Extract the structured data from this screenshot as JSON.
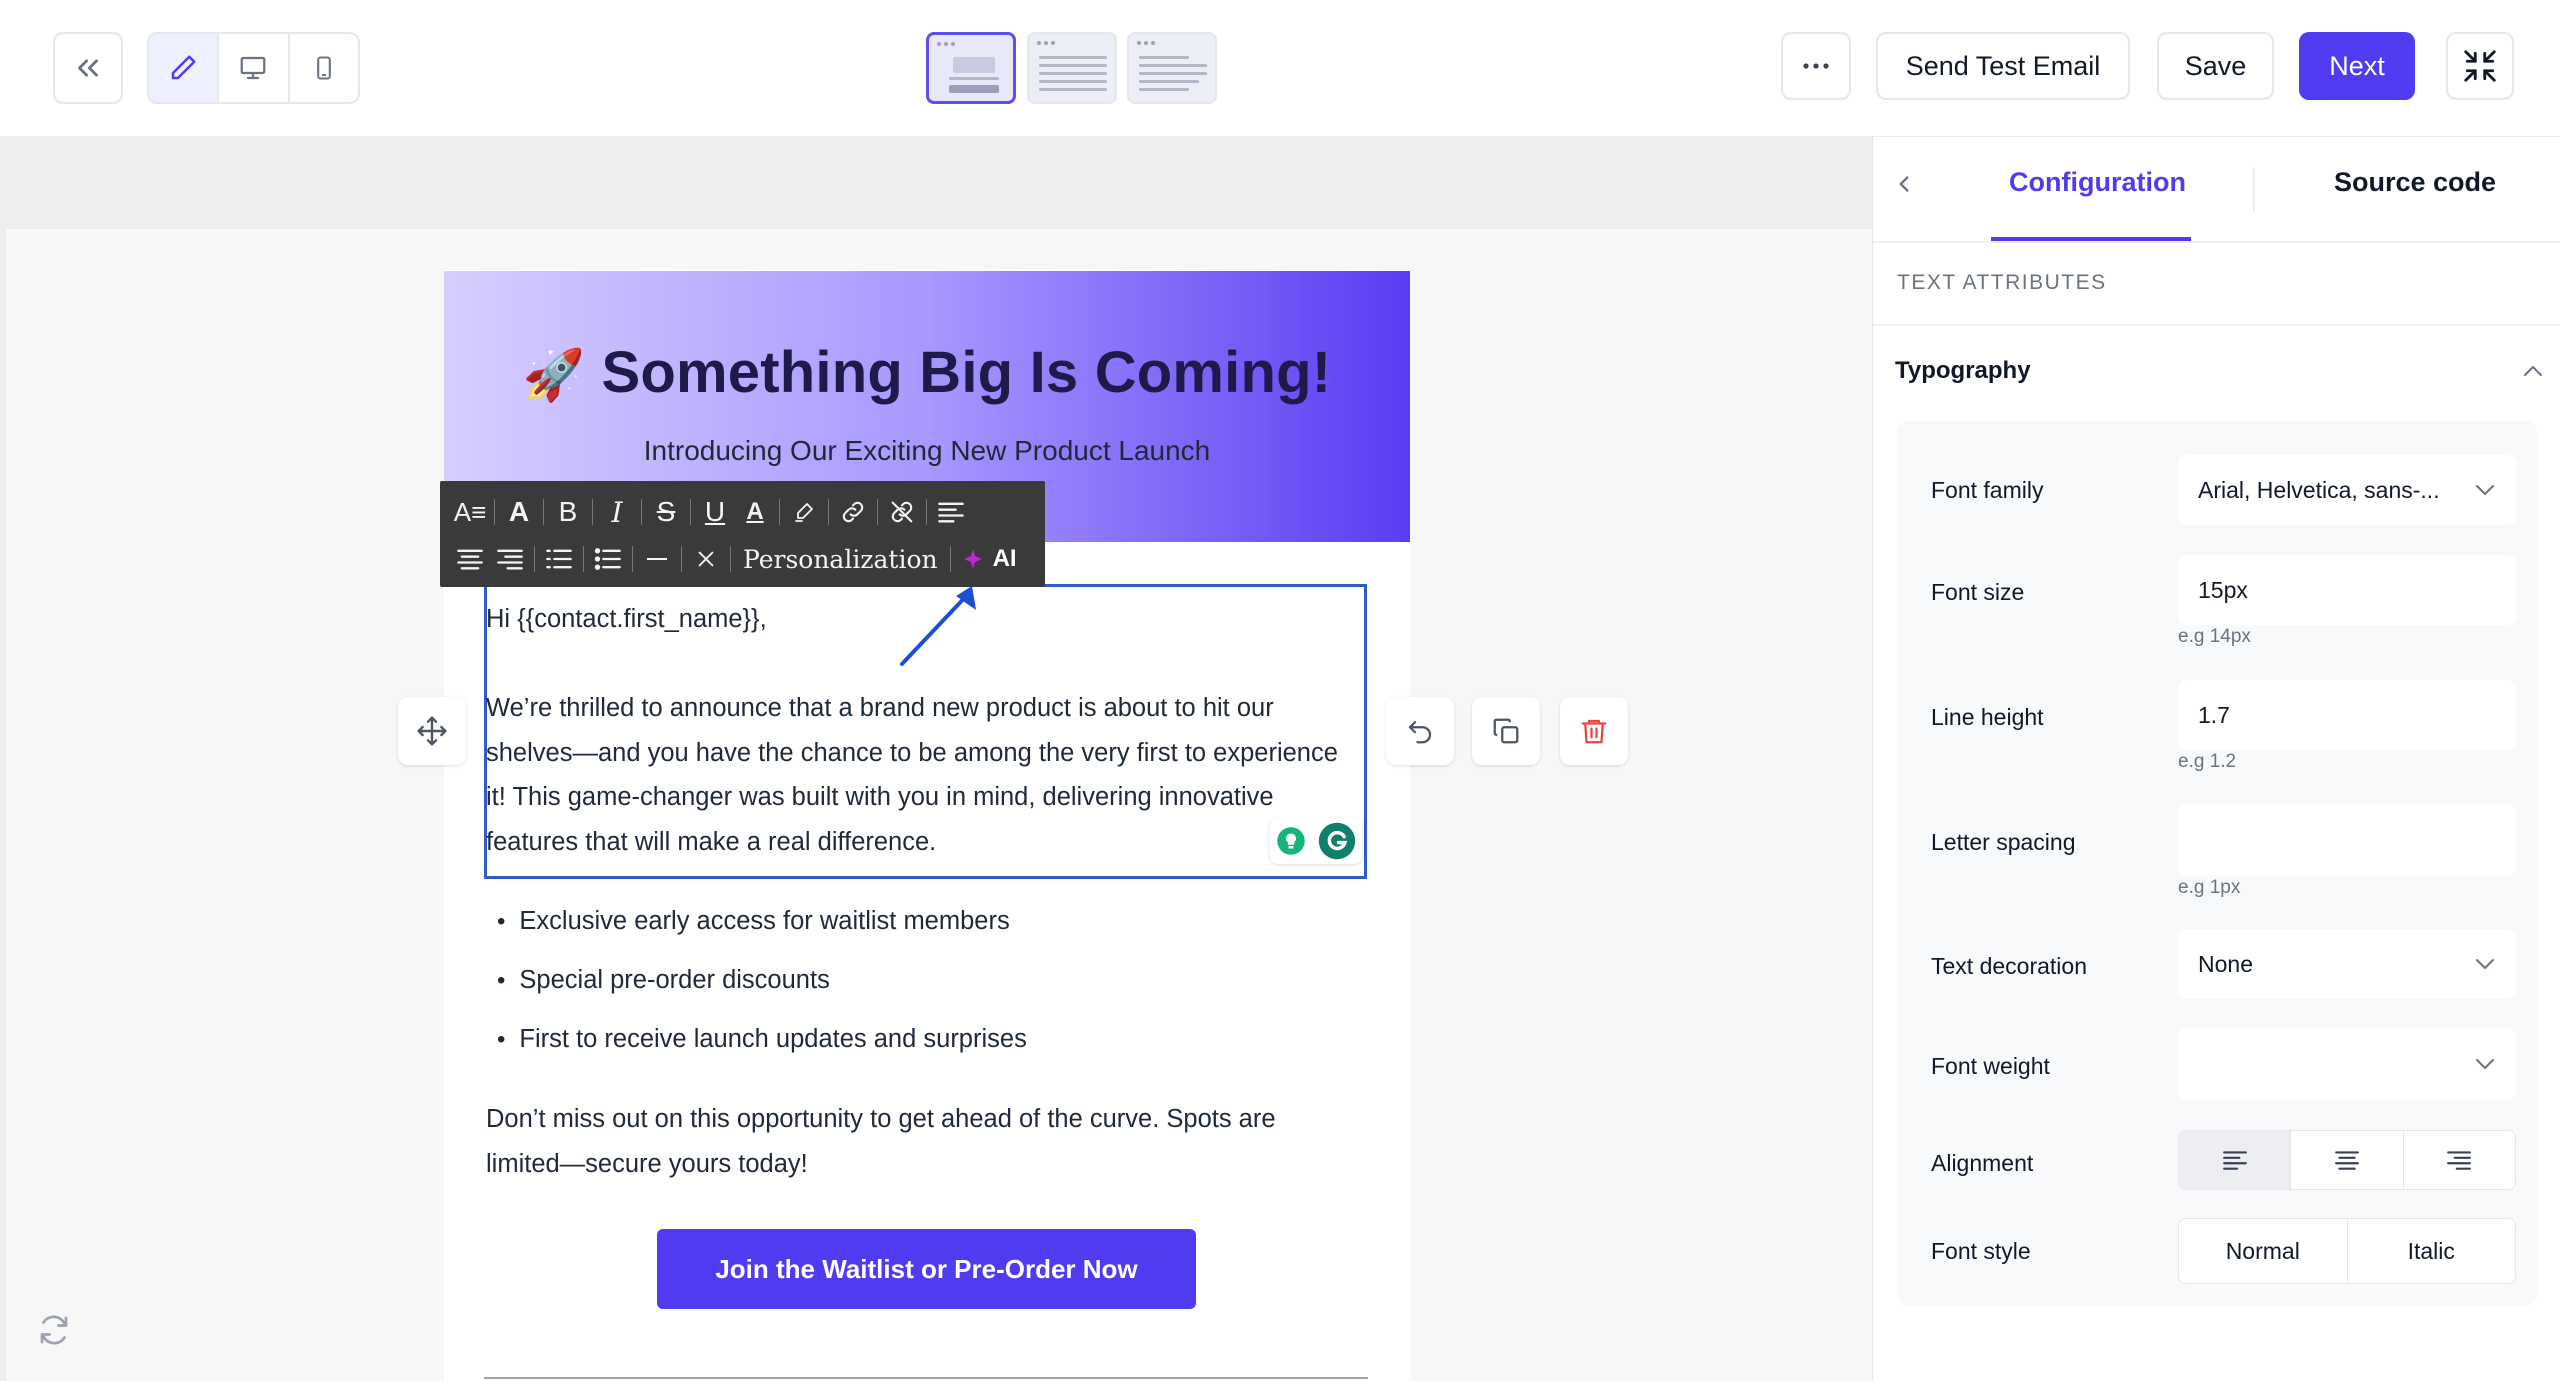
{
  "toolbar": {
    "back_icon": "double-chevron-left-icon",
    "modes": [
      {
        "name": "edit",
        "icon": "pencil-icon",
        "active": true
      },
      {
        "name": "desktop-preview",
        "icon": "monitor-icon",
        "active": false
      },
      {
        "name": "mobile-preview",
        "icon": "phone-icon",
        "active": false
      }
    ],
    "template_layouts": 3,
    "more_icon": "more-horizontal-icon",
    "send_test_label": "Send Test Email",
    "save_label": "Save",
    "next_label": "Next",
    "collapse_icon": "collapse-icon",
    "accent_color": "#4f3cf0"
  },
  "email": {
    "hero_emoji": "🚀",
    "hero_title": "Something Big Is Coming!",
    "hero_subtitle": "Introducing Our Exciting New Product Launch",
    "greeting": "Hi {{contact.first_name}},",
    "paragraph_lines": [
      "We’re thrilled to announce that a brand new product is about to hit our",
      "shelves—and you have the chance to be among the very first to experience",
      "it! This game-changer was built with you in mind, delivering innovative",
      "features that will make a real difference."
    ],
    "bullets": [
      "Exclusive early access for waitlist members",
      "Special pre-order discounts",
      "First to receive launch updates and surprises"
    ],
    "closing_lines": [
      "Don’t miss out on this opportunity to get ahead of the curve. Spots are",
      "limited—secure yours today!"
    ],
    "cta_label": "Join the Waitlist or Pre-Order Now"
  },
  "format_toolbar": {
    "personalization_label": "Personalization",
    "ai_label": "AI"
  },
  "panel": {
    "tab_configuration": "Configuration",
    "tab_source": "Source code",
    "section_label": "TEXT ATTRIBUTES",
    "typography_title": "Typography",
    "fields": {
      "font_family": {
        "label": "Font family",
        "value": "Arial, Helvetica, sans-..."
      },
      "font_size": {
        "label": "Font size",
        "value": "15px",
        "hint": "e.g 14px"
      },
      "line_height": {
        "label": "Line height",
        "value": "1.7",
        "hint": "e.g 1.2"
      },
      "letter_spacing": {
        "label": "Letter spacing",
        "value": "",
        "hint": "e.g 1px"
      },
      "text_decoration": {
        "label": "Text decoration",
        "value": "None"
      },
      "font_weight": {
        "label": "Font weight",
        "value": ""
      },
      "alignment": {
        "label": "Alignment"
      },
      "font_style": {
        "label": "Font style",
        "normal": "Normal",
        "italic": "Italic"
      }
    }
  }
}
